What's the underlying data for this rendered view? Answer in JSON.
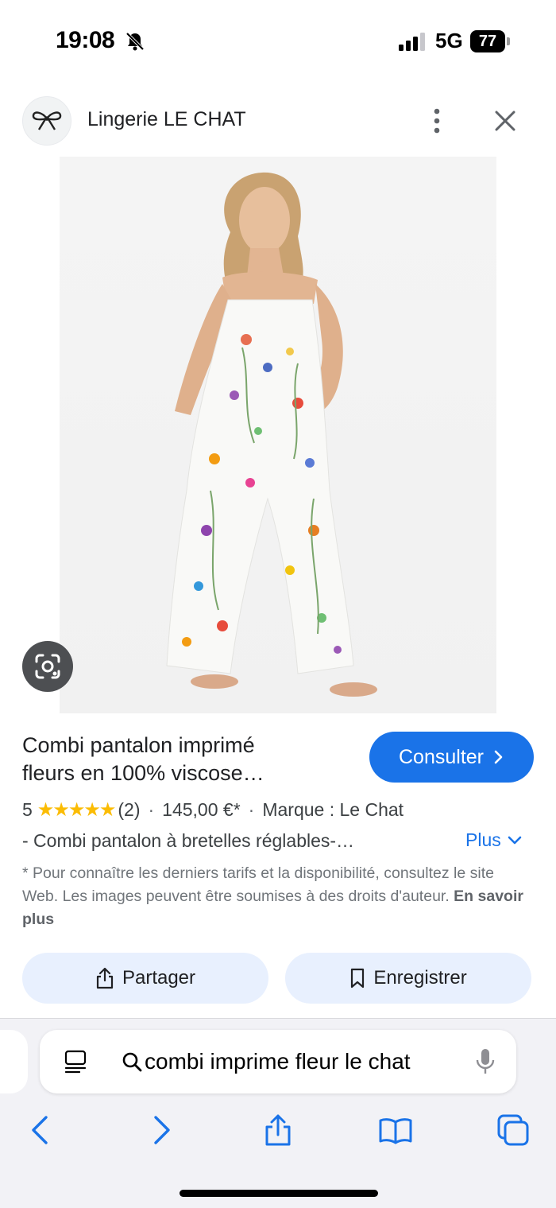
{
  "status_bar": {
    "time": "19:08",
    "network": "5G",
    "battery": "77"
  },
  "header": {
    "site_name": "Lingerie LE CHAT"
  },
  "product": {
    "title_line1": "Combi pantalon imprimé",
    "title_line2": "fleurs en 100% viscose…",
    "consult_label": "Consulter",
    "rating_value": "5",
    "rating_stars": 5,
    "rating_count": "(2)",
    "price": "145,00 €*",
    "brand": "Marque : Le Chat",
    "description": "- Combi pantalon à bretelles réglables-…",
    "more_label": "Plus",
    "disclaimer": "* Pour connaître les derniers tarifs et la disponibilité, consultez le site Web. Les images peuvent être soumises à des droits d'auteur.",
    "learn_more": "En savoir plus"
  },
  "actions": {
    "share_label": "Partager",
    "save_label": "Enregistrer"
  },
  "safari": {
    "address_text": "combi imprime fleur le chat"
  },
  "colors": {
    "accent": "#1a73e8",
    "chip_bg": "#e8f0fe",
    "star": "#fbbc04"
  }
}
